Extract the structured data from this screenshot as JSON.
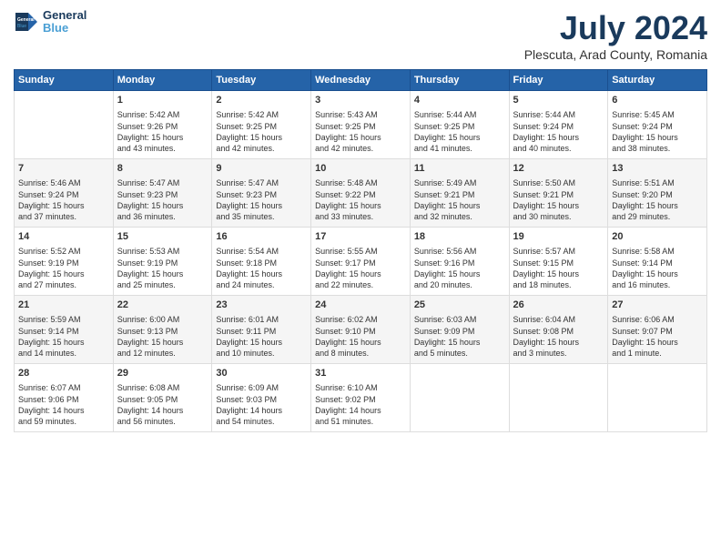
{
  "header": {
    "logo_line1": "General",
    "logo_line2": "Blue",
    "title": "July 2024",
    "subtitle": "Plescuta, Arad County, Romania"
  },
  "columns": [
    "Sunday",
    "Monday",
    "Tuesday",
    "Wednesday",
    "Thursday",
    "Friday",
    "Saturday"
  ],
  "weeks": [
    {
      "days": [
        {
          "num": "",
          "info": ""
        },
        {
          "num": "1",
          "info": "Sunrise: 5:42 AM\nSunset: 9:26 PM\nDaylight: 15 hours\nand 43 minutes."
        },
        {
          "num": "2",
          "info": "Sunrise: 5:42 AM\nSunset: 9:25 PM\nDaylight: 15 hours\nand 42 minutes."
        },
        {
          "num": "3",
          "info": "Sunrise: 5:43 AM\nSunset: 9:25 PM\nDaylight: 15 hours\nand 42 minutes."
        },
        {
          "num": "4",
          "info": "Sunrise: 5:44 AM\nSunset: 9:25 PM\nDaylight: 15 hours\nand 41 minutes."
        },
        {
          "num": "5",
          "info": "Sunrise: 5:44 AM\nSunset: 9:24 PM\nDaylight: 15 hours\nand 40 minutes."
        },
        {
          "num": "6",
          "info": "Sunrise: 5:45 AM\nSunset: 9:24 PM\nDaylight: 15 hours\nand 38 minutes."
        }
      ]
    },
    {
      "days": [
        {
          "num": "7",
          "info": "Sunrise: 5:46 AM\nSunset: 9:24 PM\nDaylight: 15 hours\nand 37 minutes."
        },
        {
          "num": "8",
          "info": "Sunrise: 5:47 AM\nSunset: 9:23 PM\nDaylight: 15 hours\nand 36 minutes."
        },
        {
          "num": "9",
          "info": "Sunrise: 5:47 AM\nSunset: 9:23 PM\nDaylight: 15 hours\nand 35 minutes."
        },
        {
          "num": "10",
          "info": "Sunrise: 5:48 AM\nSunset: 9:22 PM\nDaylight: 15 hours\nand 33 minutes."
        },
        {
          "num": "11",
          "info": "Sunrise: 5:49 AM\nSunset: 9:21 PM\nDaylight: 15 hours\nand 32 minutes."
        },
        {
          "num": "12",
          "info": "Sunrise: 5:50 AM\nSunset: 9:21 PM\nDaylight: 15 hours\nand 30 minutes."
        },
        {
          "num": "13",
          "info": "Sunrise: 5:51 AM\nSunset: 9:20 PM\nDaylight: 15 hours\nand 29 minutes."
        }
      ]
    },
    {
      "days": [
        {
          "num": "14",
          "info": "Sunrise: 5:52 AM\nSunset: 9:19 PM\nDaylight: 15 hours\nand 27 minutes."
        },
        {
          "num": "15",
          "info": "Sunrise: 5:53 AM\nSunset: 9:19 PM\nDaylight: 15 hours\nand 25 minutes."
        },
        {
          "num": "16",
          "info": "Sunrise: 5:54 AM\nSunset: 9:18 PM\nDaylight: 15 hours\nand 24 minutes."
        },
        {
          "num": "17",
          "info": "Sunrise: 5:55 AM\nSunset: 9:17 PM\nDaylight: 15 hours\nand 22 minutes."
        },
        {
          "num": "18",
          "info": "Sunrise: 5:56 AM\nSunset: 9:16 PM\nDaylight: 15 hours\nand 20 minutes."
        },
        {
          "num": "19",
          "info": "Sunrise: 5:57 AM\nSunset: 9:15 PM\nDaylight: 15 hours\nand 18 minutes."
        },
        {
          "num": "20",
          "info": "Sunrise: 5:58 AM\nSunset: 9:14 PM\nDaylight: 15 hours\nand 16 minutes."
        }
      ]
    },
    {
      "days": [
        {
          "num": "21",
          "info": "Sunrise: 5:59 AM\nSunset: 9:14 PM\nDaylight: 15 hours\nand 14 minutes."
        },
        {
          "num": "22",
          "info": "Sunrise: 6:00 AM\nSunset: 9:13 PM\nDaylight: 15 hours\nand 12 minutes."
        },
        {
          "num": "23",
          "info": "Sunrise: 6:01 AM\nSunset: 9:11 PM\nDaylight: 15 hours\nand 10 minutes."
        },
        {
          "num": "24",
          "info": "Sunrise: 6:02 AM\nSunset: 9:10 PM\nDaylight: 15 hours\nand 8 minutes."
        },
        {
          "num": "25",
          "info": "Sunrise: 6:03 AM\nSunset: 9:09 PM\nDaylight: 15 hours\nand 5 minutes."
        },
        {
          "num": "26",
          "info": "Sunrise: 6:04 AM\nSunset: 9:08 PM\nDaylight: 15 hours\nand 3 minutes."
        },
        {
          "num": "27",
          "info": "Sunrise: 6:06 AM\nSunset: 9:07 PM\nDaylight: 15 hours\nand 1 minute."
        }
      ]
    },
    {
      "days": [
        {
          "num": "28",
          "info": "Sunrise: 6:07 AM\nSunset: 9:06 PM\nDaylight: 14 hours\nand 59 minutes."
        },
        {
          "num": "29",
          "info": "Sunrise: 6:08 AM\nSunset: 9:05 PM\nDaylight: 14 hours\nand 56 minutes."
        },
        {
          "num": "30",
          "info": "Sunrise: 6:09 AM\nSunset: 9:03 PM\nDaylight: 14 hours\nand 54 minutes."
        },
        {
          "num": "31",
          "info": "Sunrise: 6:10 AM\nSunset: 9:02 PM\nDaylight: 14 hours\nand 51 minutes."
        },
        {
          "num": "",
          "info": ""
        },
        {
          "num": "",
          "info": ""
        },
        {
          "num": "",
          "info": ""
        }
      ]
    }
  ]
}
